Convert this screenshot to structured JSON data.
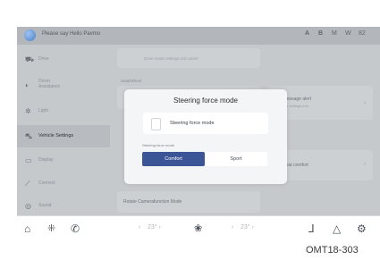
{
  "top_bar": {
    "greeting": "Please say Hello Pavmo",
    "status_icons": [
      "A",
      "B",
      "M",
      "W",
      "82"
    ]
  },
  "sidebar": {
    "items": [
      {
        "label": "Drive",
        "icon": "car-icon"
      },
      {
        "label": "Driver\nAssistance",
        "icon": "assist-icon"
      },
      {
        "label": "Light",
        "icon": "light-icon"
      },
      {
        "label": "Vehicle Settings",
        "icon": "car-settings-icon",
        "active": true
      },
      {
        "label": "Display",
        "icon": "display-icon"
      },
      {
        "label": "Connect",
        "icon": "connect-icon"
      },
      {
        "label": "Sound",
        "icon": "sound-icon"
      }
    ]
  },
  "background": {
    "hint_top": "Drive mode settings info panel",
    "section_label": "Seat/Wheel",
    "right_item_1": "Seat message alert",
    "right_item_1_sub": "Reminder settings info",
    "right_item_2": "Rear seat comfort",
    "bottom_card": "Rotate Camerafunction Mode"
  },
  "dialog": {
    "title": "Steering force mode",
    "toggle_label": "Steering force mode",
    "toggle_on": false,
    "sub_label": "Steering force mode",
    "options": [
      "Comfort",
      "Sport"
    ],
    "selected": "Comfort"
  },
  "bottom_bar": {
    "left_temp": "23° ›",
    "right_temp": "23° ›",
    "left_temp_prefix": "‹",
    "right_temp_prefix": "‹"
  },
  "caption": "OMT18-303",
  "colors": {
    "accent": "#3b5596",
    "screen_bg": "#c6c9cc",
    "dialog_bg": "#f4f5f6"
  }
}
